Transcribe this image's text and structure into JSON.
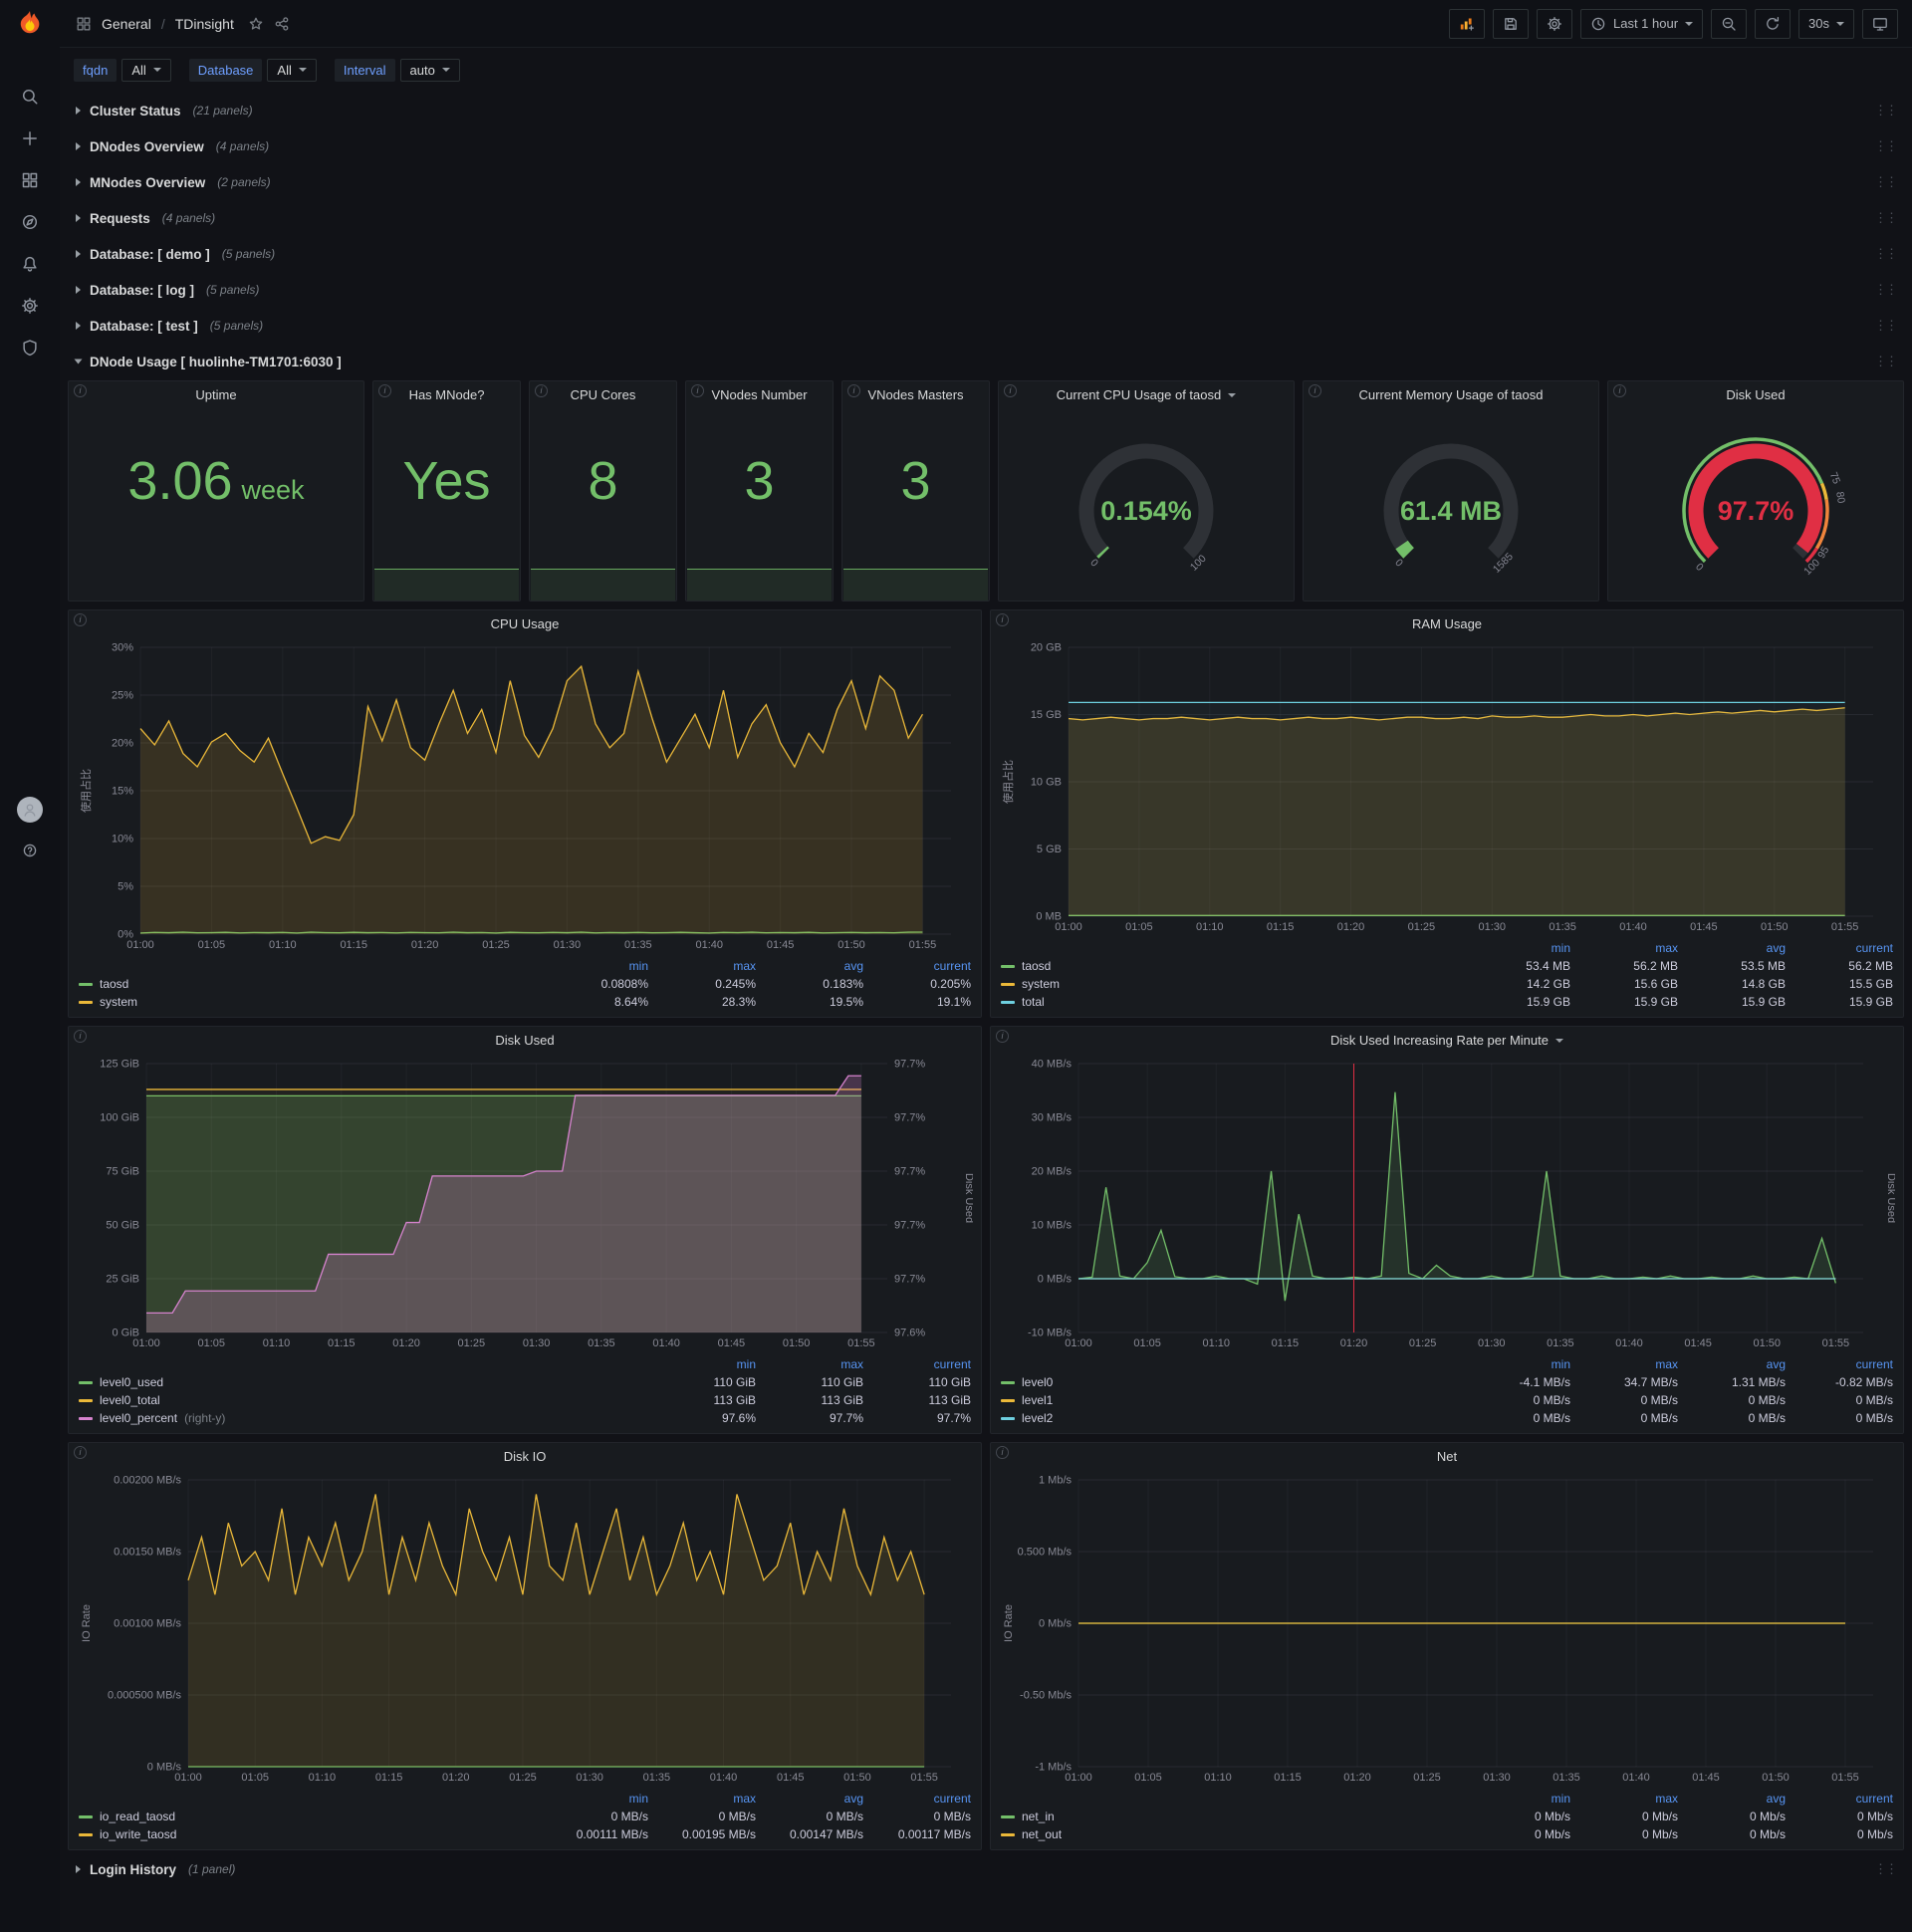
{
  "nav": {
    "breadcrumb": {
      "section": "General",
      "separator": "/",
      "page": "TDinsight"
    },
    "time_range": "Last 1 hour",
    "refresh_interval": "30s"
  },
  "sidebar": {
    "icons": [
      "search",
      "plus",
      "apps",
      "compass",
      "bell",
      "gear",
      "shield"
    ]
  },
  "variables": [
    {
      "label": "fqdn",
      "value": "All"
    },
    {
      "label": "Database",
      "value": "All"
    },
    {
      "label": "Interval",
      "value": "auto"
    }
  ],
  "rows": {
    "top": [
      {
        "label": "Cluster Status",
        "count": "(21 panels)"
      },
      {
        "label": "DNodes Overview",
        "count": "(4 panels)"
      },
      {
        "label": "MNodes Overview",
        "count": "(2 panels)"
      },
      {
        "label": "Requests",
        "count": "(4 panels)"
      },
      {
        "label": "Database: [ demo ]",
        "count": "(5 panels)"
      },
      {
        "label": "Database: [ log ]",
        "count": "(5 panels)"
      },
      {
        "label": "Database: [ test ]",
        "count": "(5 panels)"
      }
    ],
    "expanded": {
      "label": "DNode Usage [ huolinhe-TM1701:6030 ]"
    },
    "bottom": [
      {
        "label": "Login History",
        "count": "(1 panel)"
      }
    ]
  },
  "stat_panels": [
    {
      "title": "Uptime",
      "value": "3.06",
      "unit": "week",
      "sparkline": false
    },
    {
      "title": "Has MNode?",
      "value": "Yes",
      "sparkline": true
    },
    {
      "title": "CPU Cores",
      "value": "8",
      "sparkline": true
    },
    {
      "title": "VNodes Number",
      "value": "3",
      "sparkline": true
    },
    {
      "title": "VNodes Masters",
      "value": "3",
      "sparkline": true
    }
  ],
  "gauges": [
    {
      "title": "Current CPU Usage of taosd",
      "dropdown": true,
      "value_text": "0.154%",
      "value": 0.154,
      "min": 0,
      "max": 100,
      "color": "#73bf69",
      "labels": [
        [
          0,
          "0"
        ],
        [
          100,
          "100"
        ]
      ]
    },
    {
      "title": "Current Memory Usage of taosd",
      "dropdown": false,
      "value_text": "61.4 MB",
      "value": 61.4,
      "min": 0,
      "max": 1585,
      "color": "#73bf69",
      "labels": [
        [
          0,
          "0"
        ],
        [
          1585,
          "1585"
        ]
      ]
    },
    {
      "title": "Disk Used",
      "dropdown": false,
      "value_text": "97.7%",
      "value": 97.7,
      "min": 0,
      "max": 100,
      "color": "#e02f44",
      "labels": [
        [
          0,
          "0"
        ],
        [
          75,
          "75"
        ],
        [
          80,
          "80"
        ],
        [
          95,
          "95"
        ],
        [
          100,
          "100"
        ]
      ],
      "ring_segments": [
        [
          0,
          75,
          "#73bf69"
        ],
        [
          75,
          80,
          "#eab839"
        ],
        [
          80,
          95,
          "#ef843c"
        ],
        [
          95,
          100,
          "#e02f44"
        ]
      ]
    }
  ],
  "chart_data": [
    {
      "type": "line",
      "title": "CPU Usage",
      "ylabel": "使用占比",
      "ylim": [
        0,
        30
      ],
      "yticks": [
        "0%",
        "5%",
        "10%",
        "15%",
        "20%",
        "25%",
        "30%"
      ],
      "xticks": [
        "01:00",
        "01:05",
        "01:10",
        "01:15",
        "01:20",
        "01:25",
        "01:30",
        "01:35",
        "01:40",
        "01:45",
        "01:50",
        "01:55"
      ],
      "legend_cols": [
        "min",
        "max",
        "avg",
        "current"
      ],
      "left_pad": 64,
      "series": [
        {
          "name": "taosd",
          "color": "#73bf69",
          "fill_opacity": 0.08,
          "values": [
            0.12,
            0.18,
            0.15,
            0.2,
            0.14,
            0.16,
            0.19,
            0.13,
            0.17,
            0.15,
            0.18,
            0.12,
            0.2,
            0.16,
            0.14,
            0.19,
            0.15,
            0.17,
            0.13,
            0.18,
            0.16,
            0.14,
            0.2,
            0.15,
            0.17,
            0.12,
            0.19,
            0.16,
            0.14,
            0.18,
            0.15,
            0.2,
            0.13,
            0.17,
            0.15,
            0.18,
            0.14,
            0.16,
            0.19,
            0.15,
            0.12,
            0.18,
            0.16,
            0.2,
            0.14,
            0.17,
            0.15,
            0.19,
            0.13,
            0.16,
            0.18,
            0.15,
            0.17,
            0.14,
            0.2,
            0.21
          ],
          "stats": [
            "0.0808%",
            "0.245%",
            "0.183%",
            "0.205%"
          ]
        },
        {
          "name": "system",
          "color": "#eab839",
          "fill_opacity": 0.15,
          "values": [
            21.5,
            19.8,
            22.3,
            18.9,
            17.5,
            20.1,
            21.0,
            19.2,
            18.0,
            20.5,
            16.8,
            13.2,
            9.5,
            10.2,
            9.8,
            12.5,
            23.8,
            20.2,
            24.5,
            19.5,
            18.2,
            22.0,
            25.5,
            21.0,
            23.5,
            19.0,
            26.5,
            20.8,
            18.5,
            21.5,
            26.5,
            28.0,
            22.0,
            19.5,
            21.0,
            27.5,
            22.5,
            18.0,
            20.5,
            23.0,
            19.5,
            25.5,
            18.5,
            22.0,
            24.0,
            20.0,
            17.5,
            21.0,
            19.0,
            23.5,
            26.5,
            21.5,
            27.0,
            25.5,
            20.5,
            23.0
          ],
          "stats": [
            "8.64%",
            "28.3%",
            "19.5%",
            "19.1%"
          ]
        }
      ]
    },
    {
      "type": "line",
      "title": "RAM Usage",
      "ylabel": "使用占比",
      "ylim": [
        0,
        20
      ],
      "yticks": [
        "0 MB",
        "5 GB",
        "10 GB",
        "15 GB",
        "20 GB"
      ],
      "xticks": [
        "01:00",
        "01:05",
        "01:10",
        "01:15",
        "01:20",
        "01:25",
        "01:30",
        "01:35",
        "01:40",
        "01:45",
        "01:50",
        "01:55"
      ],
      "legend_cols": [
        "min",
        "max",
        "avg",
        "current"
      ],
      "left_pad": 70,
      "series": [
        {
          "name": "taosd",
          "color": "#73bf69",
          "constant": 0.052,
          "fill_opacity": 0.08,
          "stats": [
            "53.4 MB",
            "56.2 MB",
            "53.5 MB",
            "56.2 MB"
          ]
        },
        {
          "name": "system",
          "color": "#eab839",
          "fill_opacity": 0.15,
          "values": [
            14.7,
            14.6,
            14.7,
            14.8,
            14.7,
            14.6,
            14.7,
            14.7,
            14.8,
            14.7,
            14.6,
            14.7,
            14.8,
            14.7,
            14.7,
            14.6,
            14.7,
            14.8,
            14.7,
            14.7,
            14.8,
            14.7,
            14.6,
            14.7,
            14.8,
            14.8,
            14.7,
            14.7,
            14.8,
            14.7,
            14.9,
            14.8,
            14.8,
            14.9,
            14.8,
            14.8,
            14.9,
            15.0,
            14.9,
            14.9,
            15.0,
            14.9,
            15.0,
            15.1,
            15.0,
            15.1,
            15.2,
            15.1,
            15.2,
            15.3,
            15.2,
            15.3,
            15.4,
            15.3,
            15.4,
            15.5
          ],
          "stats": [
            "14.2 GB",
            "15.6 GB",
            "14.8 GB",
            "15.5 GB"
          ]
        },
        {
          "name": "total",
          "color": "#6ed0e0",
          "constant": 15.9,
          "fill_opacity": 0.04,
          "stats": [
            "15.9 GB",
            "15.9 GB",
            "15.9 GB",
            "15.9 GB"
          ]
        }
      ]
    },
    {
      "type": "line",
      "title": "Disk Used",
      "ylim": [
        0,
        125
      ],
      "yticks": [
        "0 GiB",
        "25 GiB",
        "50 GiB",
        "75 GiB",
        "100 GiB",
        "125 GiB"
      ],
      "right_ylim": [
        97.595,
        97.705
      ],
      "right_yticks": [
        "97.6%",
        "97.7%",
        "97.7%",
        "97.7%",
        "97.7%",
        "97.7%"
      ],
      "right_label": "Disk Used",
      "xticks": [
        "01:00",
        "01:05",
        "01:10",
        "01:15",
        "01:20",
        "01:25",
        "01:30",
        "01:35",
        "01:40",
        "01:45",
        "01:50",
        "01:55"
      ],
      "legend_cols": [
        "min",
        "max",
        "current"
      ],
      "left_pad": 70,
      "right_pad": 86,
      "series": [
        {
          "name": "level0_used",
          "color": "#73bf69",
          "constant": 110,
          "fill_opacity": 0.22,
          "stats": [
            "110 GiB",
            "110 GiB",
            "110 GiB"
          ]
        },
        {
          "name": "level0_total",
          "color": "#eab839",
          "constant": 113,
          "fill_opacity": 0.05,
          "stats": [
            "113 GiB",
            "113 GiB",
            "113 GiB"
          ]
        },
        {
          "name": "level0_percent",
          "suffix": "(right-y)",
          "color": "#d683ce",
          "axis": "right",
          "fill_opacity": 0.25,
          "steps": [
            [
              3,
              97.603
            ],
            [
              11,
              97.612
            ],
            [
              6,
              97.627
            ],
            [
              2,
              97.64
            ],
            [
              8,
              97.659
            ],
            [
              3,
              97.661
            ],
            [
              21,
              97.692
            ],
            [
              2,
              97.7
            ]
          ],
          "stats": [
            "97.6%",
            "97.7%",
            "97.7%"
          ]
        }
      ]
    },
    {
      "type": "line",
      "title": "Disk Used Increasing Rate per Minute",
      "dropdown": true,
      "ylim": [
        -10,
        40
      ],
      "yticks": [
        "-10 MB/s",
        "0 MB/s",
        "10 MB/s",
        "20 MB/s",
        "30 MB/s",
        "40 MB/s"
      ],
      "right_label": "Disk Used",
      "xticks": [
        "01:00",
        "01:05",
        "01:10",
        "01:15",
        "01:20",
        "01:25",
        "01:30",
        "01:35",
        "01:40",
        "01:45",
        "01:50",
        "01:55"
      ],
      "legend_cols": [
        "min",
        "max",
        "avg",
        "current"
      ],
      "left_pad": 80,
      "right_pad": 32,
      "annotation": {
        "minute": 20,
        "color": "#e02f44"
      },
      "series": [
        {
          "name": "level0",
          "color": "#73bf69",
          "fill_opacity": 0.15,
          "values": [
            0,
            0.3,
            17,
            0.5,
            0,
            3,
            9,
            0.4,
            0,
            0,
            0.5,
            0,
            0,
            -1,
            20,
            -4.1,
            12,
            0.5,
            0,
            0,
            0.3,
            0,
            0.5,
            34.7,
            1,
            0,
            2.5,
            0.5,
            0,
            0,
            0.5,
            0,
            0,
            0.5,
            20,
            0.5,
            0,
            0,
            0.5,
            0,
            0,
            0.3,
            0,
            0.5,
            0,
            0,
            0.3,
            0,
            0,
            0.5,
            0,
            0,
            0.3,
            0,
            7.5,
            -0.82
          ],
          "stats": [
            "-4.1 MB/s",
            "34.7 MB/s",
            "1.31 MB/s",
            "-0.82 MB/s"
          ]
        },
        {
          "name": "level1",
          "color": "#eab839",
          "constant": 0,
          "fill_opacity": 0.05,
          "stats": [
            "0 MB/s",
            "0 MB/s",
            "0 MB/s",
            "0 MB/s"
          ]
        },
        {
          "name": "level2",
          "color": "#6ed0e0",
          "constant": 0,
          "fill_opacity": 0.05,
          "stats": [
            "0 MB/s",
            "0 MB/s",
            "0 MB/s",
            "0 MB/s"
          ]
        }
      ]
    },
    {
      "type": "line",
      "title": "Disk IO",
      "ylabel": "IO Rate",
      "ylim": [
        0,
        0.002
      ],
      "yticks": [
        "0 MB/s",
        "0.000500 MB/s",
        "0.00100 MB/s",
        "0.00150 MB/s",
        "0.00200 MB/s"
      ],
      "xticks": [
        "01:00",
        "01:05",
        "01:10",
        "01:15",
        "01:20",
        "01:25",
        "01:30",
        "01:35",
        "01:40",
        "01:45",
        "01:50",
        "01:55"
      ],
      "legend_cols": [
        "min",
        "max",
        "avg",
        "current"
      ],
      "left_pad": 112,
      "series": [
        {
          "name": "io_read_taosd",
          "color": "#73bf69",
          "constant": 0,
          "fill_opacity": 0.06,
          "stats": [
            "0 MB/s",
            "0 MB/s",
            "0 MB/s",
            "0 MB/s"
          ]
        },
        {
          "name": "io_write_taosd",
          "color": "#eab839",
          "fill_opacity": 0.13,
          "values": [
            0.0013,
            0.0016,
            0.0012,
            0.0017,
            0.0014,
            0.0015,
            0.0013,
            0.0018,
            0.0012,
            0.0016,
            0.0014,
            0.0017,
            0.0013,
            0.0015,
            0.0019,
            0.0012,
            0.0016,
            0.0013,
            0.0017,
            0.0014,
            0.0012,
            0.0018,
            0.0015,
            0.0013,
            0.0016,
            0.0012,
            0.0019,
            0.0014,
            0.0013,
            0.0017,
            0.0012,
            0.0015,
            0.0018,
            0.0013,
            0.0016,
            0.0012,
            0.0014,
            0.0017,
            0.0013,
            0.0015,
            0.0012,
            0.0019,
            0.0016,
            0.0013,
            0.0014,
            0.0017,
            0.0012,
            0.0015,
            0.0013,
            0.0018,
            0.0014,
            0.0012,
            0.0016,
            0.0013,
            0.0015,
            0.0012
          ],
          "stats": [
            "0.00111 MB/s",
            "0.00195 MB/s",
            "0.00147 MB/s",
            "0.00117 MB/s"
          ]
        }
      ]
    },
    {
      "type": "line",
      "title": "Net",
      "ylabel": "IO Rate",
      "ylim": [
        -1,
        1
      ],
      "yticks": [
        "-1 Mb/s",
        "-0.50 Mb/s",
        "0 Mb/s",
        "0.500 Mb/s",
        "1 Mb/s"
      ],
      "xticks": [
        "01:00",
        "01:05",
        "01:10",
        "01:15",
        "01:20",
        "01:25",
        "01:30",
        "01:35",
        "01:40",
        "01:45",
        "01:50",
        "01:55"
      ],
      "legend_cols": [
        "min",
        "max",
        "avg",
        "current"
      ],
      "left_pad": 80,
      "series": [
        {
          "name": "net_in",
          "color": "#73bf69",
          "constant": 0,
          "fill_opacity": 0.06,
          "stats": [
            "0 Mb/s",
            "0 Mb/s",
            "0 Mb/s",
            "0 Mb/s"
          ]
        },
        {
          "name": "net_out",
          "color": "#eab839",
          "constant": 0,
          "fill_opacity": 0.1,
          "stats": [
            "0 Mb/s",
            "0 Mb/s",
            "0 Mb/s",
            "0 Mb/s"
          ]
        }
      ]
    }
  ]
}
